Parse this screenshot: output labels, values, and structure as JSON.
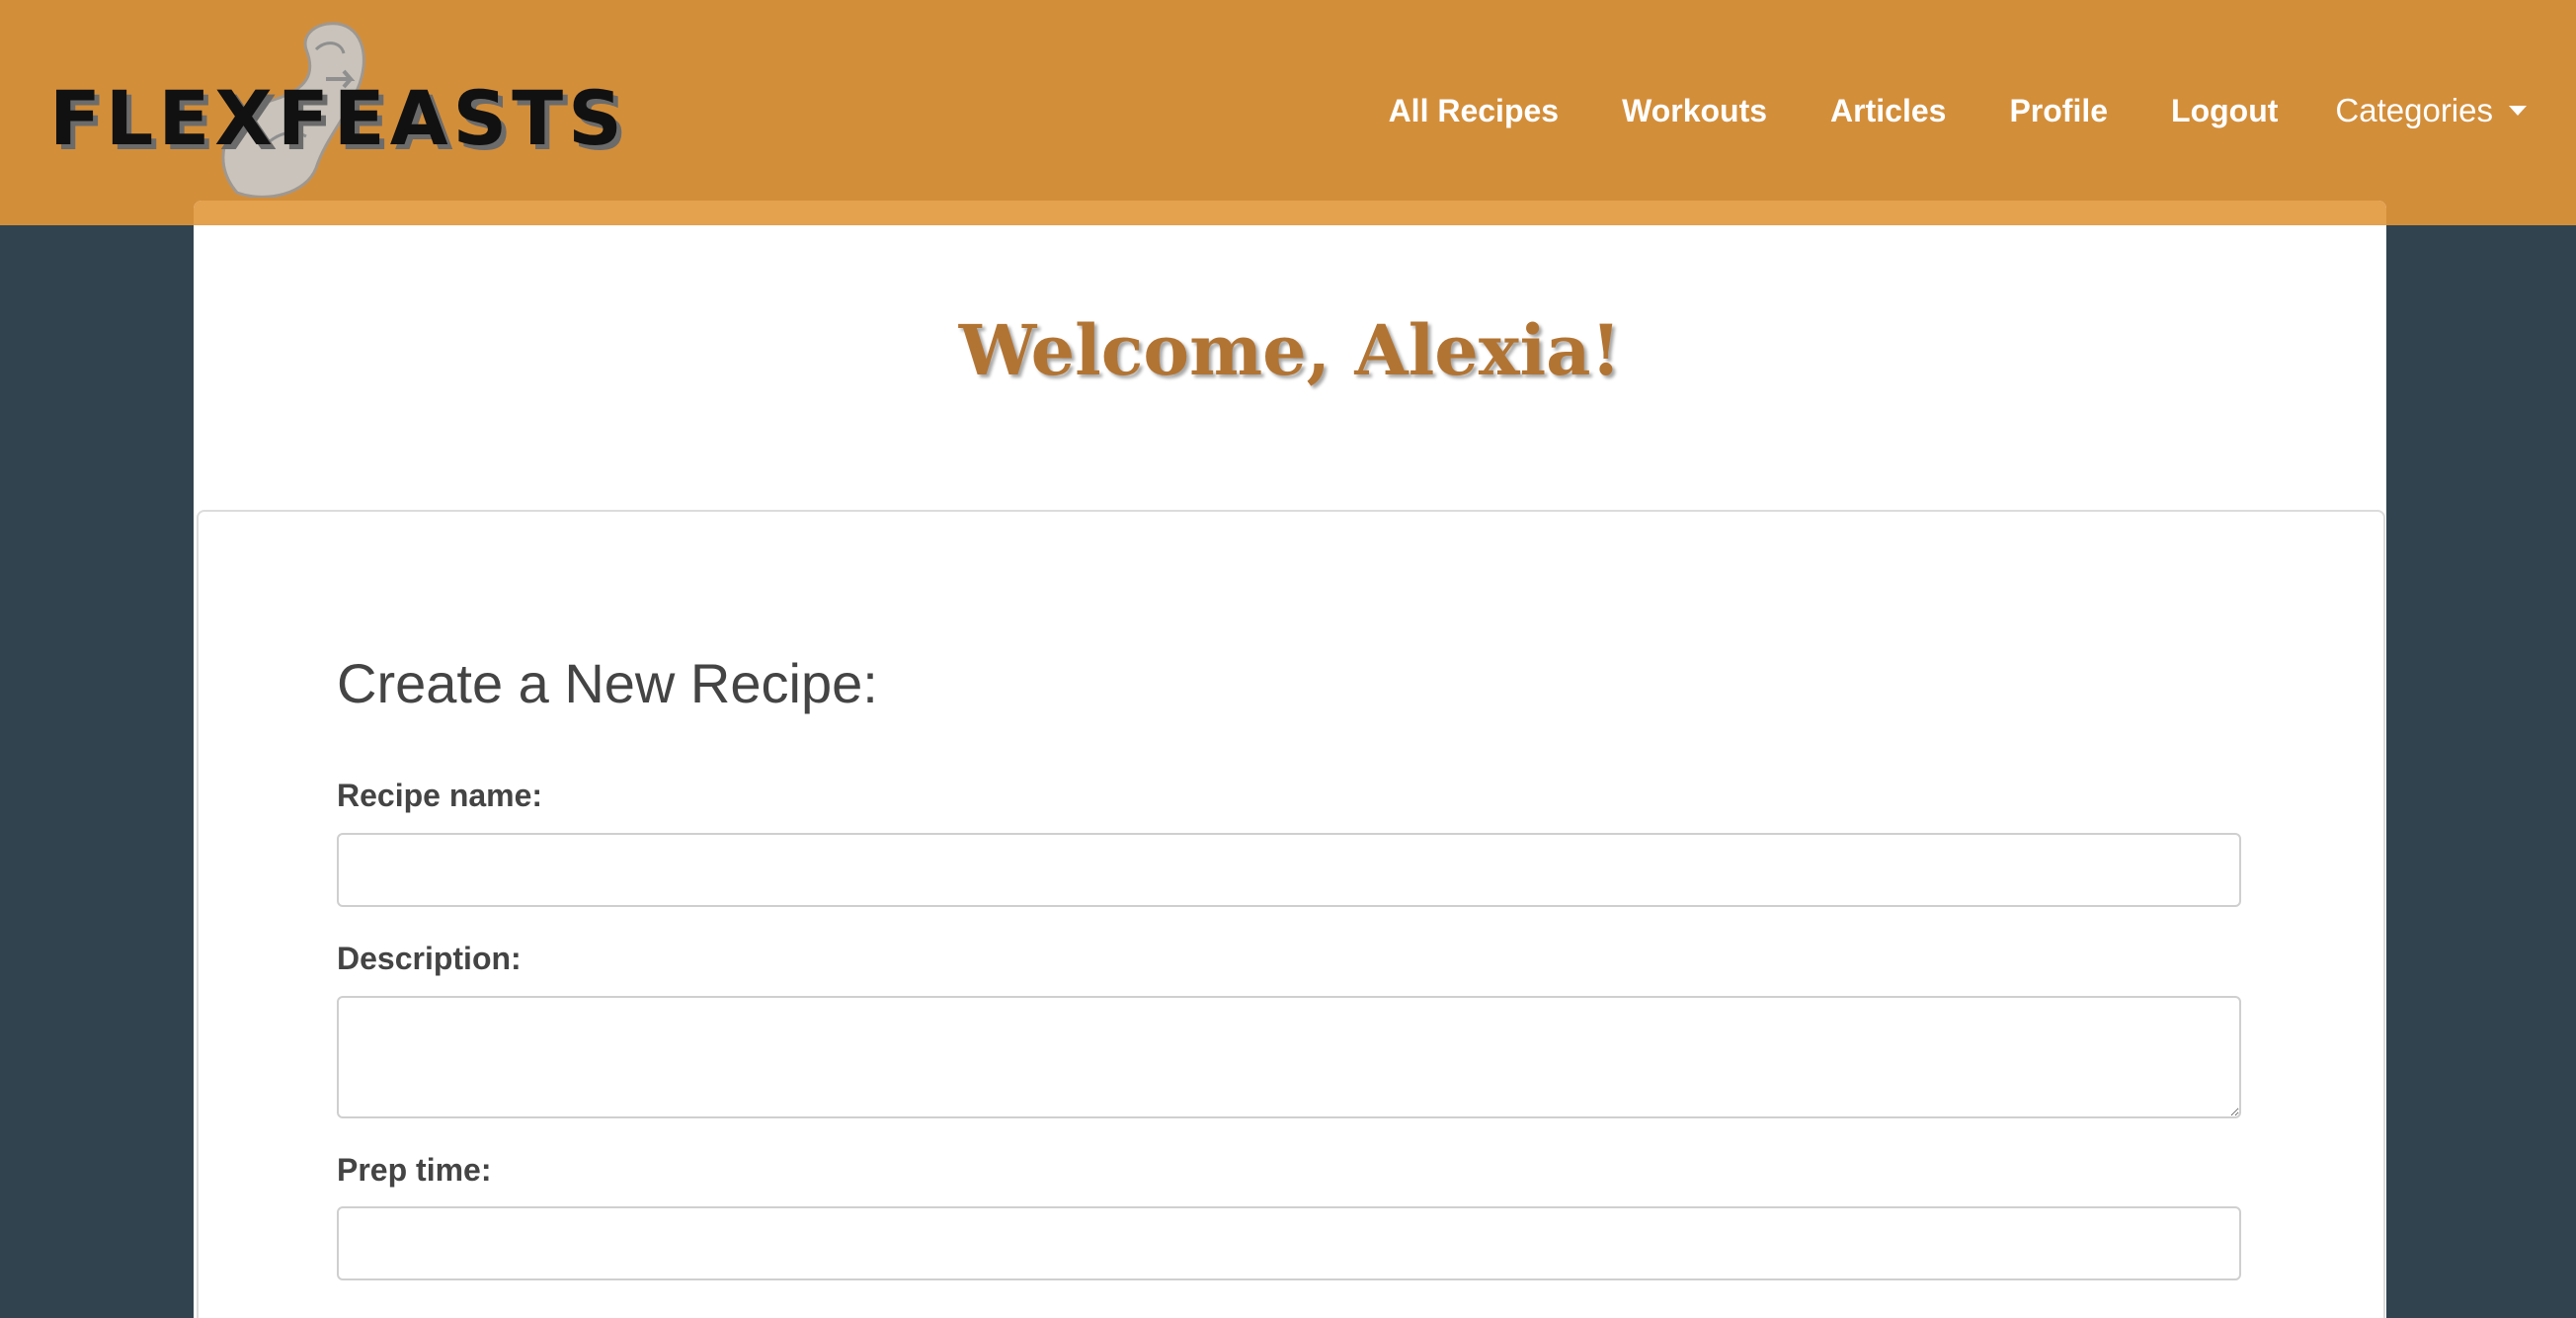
{
  "brand": {
    "name": "FLEXFEASTS"
  },
  "colors": {
    "navbar": "#d38e3a",
    "background": "#31434f",
    "accent_strip": "#e4a14e",
    "welcome_text": "#b27433",
    "form_text": "#444444"
  },
  "nav": {
    "items": [
      {
        "label": "All Recipes"
      },
      {
        "label": "Workouts"
      },
      {
        "label": "Articles"
      },
      {
        "label": "Profile"
      },
      {
        "label": "Logout"
      }
    ],
    "dropdown": {
      "label": "Categories",
      "icon": "caret-down-icon"
    }
  },
  "welcome": {
    "text": "Welcome, Alexia!"
  },
  "form": {
    "title": "Create a New Recipe:",
    "fields": [
      {
        "label": "Recipe name:",
        "value": "",
        "placeholder": ""
      },
      {
        "label": "Description:",
        "value": "",
        "placeholder": ""
      },
      {
        "label": "Prep time:",
        "value": "",
        "placeholder": ""
      }
    ]
  }
}
